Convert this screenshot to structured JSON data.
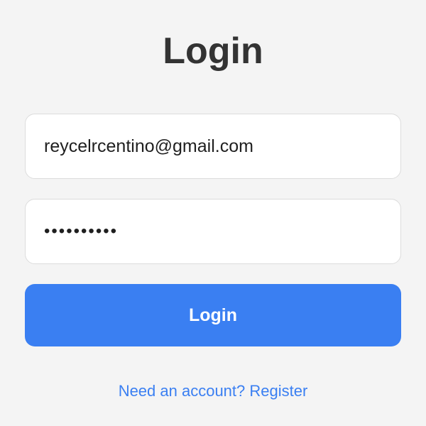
{
  "page": {
    "title": "Login"
  },
  "form": {
    "email_value": "reycelrcentino@gmail.com",
    "password_value": "••••••••••",
    "submit_label": "Login"
  },
  "footer": {
    "register_link": "Need an account? Register"
  },
  "colors": {
    "background": "#f4f4f4",
    "accent": "#3a7ff2",
    "title_text": "#333333"
  }
}
